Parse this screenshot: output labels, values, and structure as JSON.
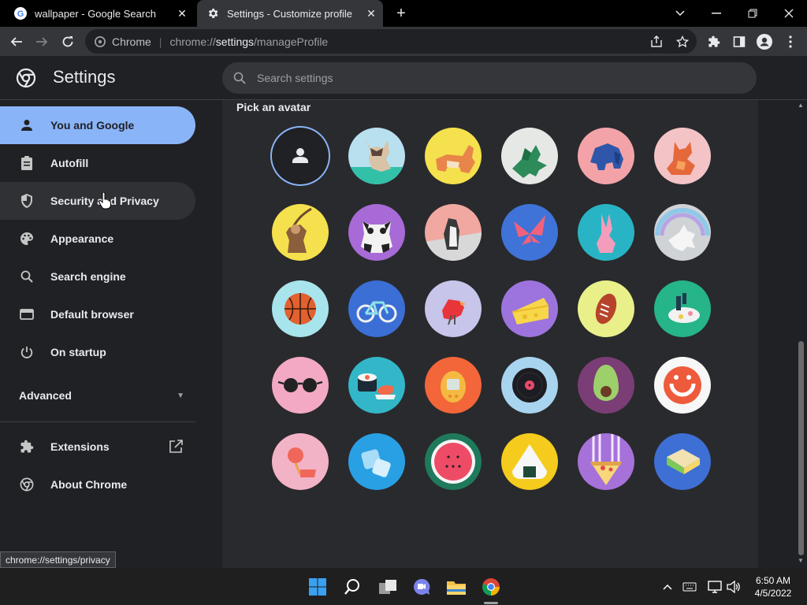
{
  "tabs": [
    {
      "title": "wallpaper - Google Search",
      "icon": "google-g-icon",
      "active": false
    },
    {
      "title": "Settings - Customize profile",
      "icon": "gear-icon",
      "active": true
    }
  ],
  "omnibox": {
    "chip_label": "Chrome",
    "url_scheme": "chrome://",
    "url_host": "settings",
    "url_path": "/manageProfile"
  },
  "settings": {
    "title": "Settings",
    "search_placeholder": "Search settings"
  },
  "sidebar": {
    "items": [
      {
        "label": "You and Google",
        "icon": "person-icon"
      },
      {
        "label": "Autofill",
        "icon": "clipboard-icon"
      },
      {
        "label": "Security and Privacy",
        "icon": "shield-icon"
      },
      {
        "label": "Appearance",
        "icon": "palette-icon"
      },
      {
        "label": "Search engine",
        "icon": "search-icon"
      },
      {
        "label": "Default browser",
        "icon": "browser-window-icon"
      },
      {
        "label": "On startup",
        "icon": "power-icon"
      }
    ],
    "advanced_label": "Advanced",
    "extensions_label": "Extensions",
    "about_label": "About Chrome"
  },
  "main": {
    "section_title": "Pick an avatar",
    "avatars": [
      "default-person",
      "cat",
      "corgi",
      "dragon",
      "elephant",
      "fox",
      "monkey",
      "panda",
      "penguin",
      "butterfly",
      "rabbit",
      "unicorn",
      "basketball",
      "bicycle",
      "bird",
      "cheese",
      "football",
      "burger",
      "sunglasses",
      "sushi",
      "tamagotchi",
      "vinyl",
      "avocado",
      "smiley",
      "ice-cream",
      "ice-cubes",
      "watermelon",
      "onigiri",
      "pizza",
      "sandwich"
    ]
  },
  "status_bubble": "chrome://settings/privacy",
  "taskbar": {
    "time": "6:50 AM",
    "date": "4/5/2022"
  },
  "colors": {
    "accent": "#8ab4f8",
    "bg": "#202124",
    "panel": "#292a2d"
  }
}
